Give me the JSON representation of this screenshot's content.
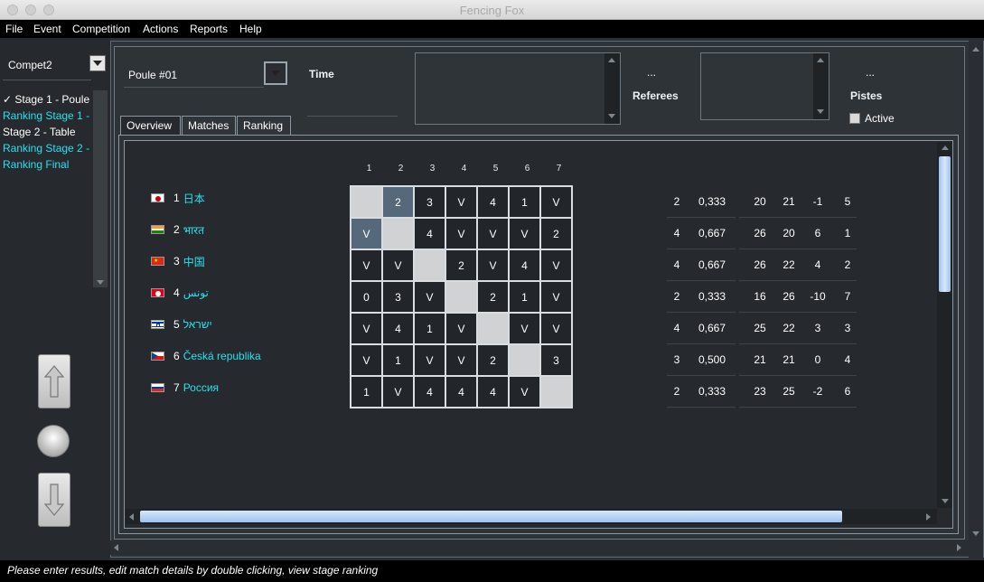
{
  "window": {
    "title": "Fencing Fox"
  },
  "menu": [
    "File",
    "Event",
    "Competition",
    "Actions",
    "Reports",
    "Help"
  ],
  "left": {
    "competition": "Compet2",
    "stages": [
      {
        "label": "✓ Stage 1 - Poule",
        "color": "white"
      },
      {
        "label": "Ranking Stage 1 -",
        "color": "cyan"
      },
      {
        "label": "Stage 2 - Table",
        "color": "white"
      },
      {
        "label": "Ranking Stage 2 -",
        "color": "cyan"
      },
      {
        "label": "Ranking Final",
        "color": "cyan"
      }
    ]
  },
  "top": {
    "poule": "Poule #01",
    "time_label": "Time",
    "referees_dots": "...",
    "referees_label": "Referees",
    "pistes_dots": "...",
    "pistes_label": "Pistes",
    "active_label": "Active"
  },
  "tabs": [
    "Overview",
    "Matches",
    "Ranking"
  ],
  "pool": {
    "columns": [
      "1",
      "2",
      "3",
      "4",
      "5",
      "6",
      "7"
    ],
    "fencers": [
      {
        "num": "1",
        "name": "日本",
        "flag": "jp"
      },
      {
        "num": "2",
        "name": "भारत",
        "flag": "in"
      },
      {
        "num": "3",
        "name": "中国",
        "flag": "cn"
      },
      {
        "num": "4",
        "name": "تونس",
        "flag": "tn"
      },
      {
        "num": "5",
        "name": "ישראל",
        "flag": "il"
      },
      {
        "num": "6",
        "name": "Česká republika",
        "flag": "cz"
      },
      {
        "num": "7",
        "name": "Россия",
        "flag": "ru"
      }
    ],
    "results": [
      [
        "",
        "2",
        "3",
        "V",
        "4",
        "1",
        "V"
      ],
      [
        "V",
        "",
        "4",
        "V",
        "V",
        "V",
        "2"
      ],
      [
        "V",
        "V",
        "",
        "2",
        "V",
        "4",
        "V"
      ],
      [
        "0",
        "3",
        "V",
        "",
        "2",
        "1",
        "V"
      ],
      [
        "V",
        "4",
        "1",
        "V",
        "",
        "V",
        "V"
      ],
      [
        "V",
        "1",
        "V",
        "V",
        "2",
        "",
        "3"
      ],
      [
        "1",
        "V",
        "4",
        "4",
        "4",
        "V",
        ""
      ]
    ],
    "stats": [
      [
        "2",
        "0,333",
        "20",
        "21",
        "-1",
        "5"
      ],
      [
        "4",
        "0,667",
        "26",
        "20",
        "6",
        "1"
      ],
      [
        "4",
        "0,667",
        "26",
        "22",
        "4",
        "2"
      ],
      [
        "2",
        "0,333",
        "16",
        "26",
        "-10",
        "7"
      ],
      [
        "4",
        "0,667",
        "25",
        "22",
        "3",
        "3"
      ],
      [
        "3",
        "0,500",
        "21",
        "21",
        "0",
        "4"
      ],
      [
        "2",
        "0,333",
        "23",
        "25",
        "-2",
        "6"
      ]
    ]
  },
  "status": "Please enter results, edit match details by double clicking, view stage ranking",
  "colors": {
    "accent_cyan": "#28e0ef",
    "selected_cell": "#56697a",
    "diagonal": "#d0d2d4"
  }
}
